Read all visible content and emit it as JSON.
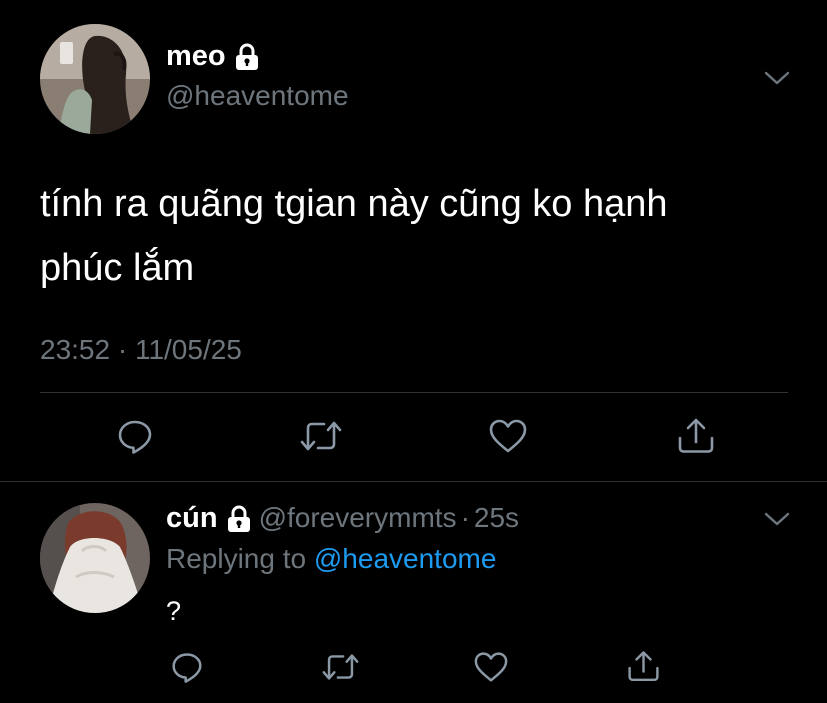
{
  "tweet": {
    "display_name": "meo",
    "handle": "@heaventome",
    "text_line1": "tính ra quãng tgian này cũng ko hạnh",
    "text_line2": "phúc lắm",
    "timestamp": "23:52 · 11/05/25",
    "avatar_icon": "person-mirror-selfie-avatar"
  },
  "reply": {
    "display_name": "cún",
    "handle": "@foreverymmts",
    "separator": "·",
    "time_ago": "25s",
    "replying_prefix": "Replying to",
    "replying_handle": "@heaventome",
    "text": "?",
    "avatar_icon": "person-covering-face-avatar"
  },
  "icons": {
    "lock": "lock-icon",
    "chevron": "chevron-down-icon",
    "reply": "reply-icon",
    "retweet": "retweet-icon",
    "like": "heart-icon",
    "share": "share-icon"
  },
  "colors": {
    "background": "#000000",
    "text": "#ffffff",
    "secondary": "#6e767d",
    "link": "#1d9bf0",
    "divider": "#2f3336"
  }
}
